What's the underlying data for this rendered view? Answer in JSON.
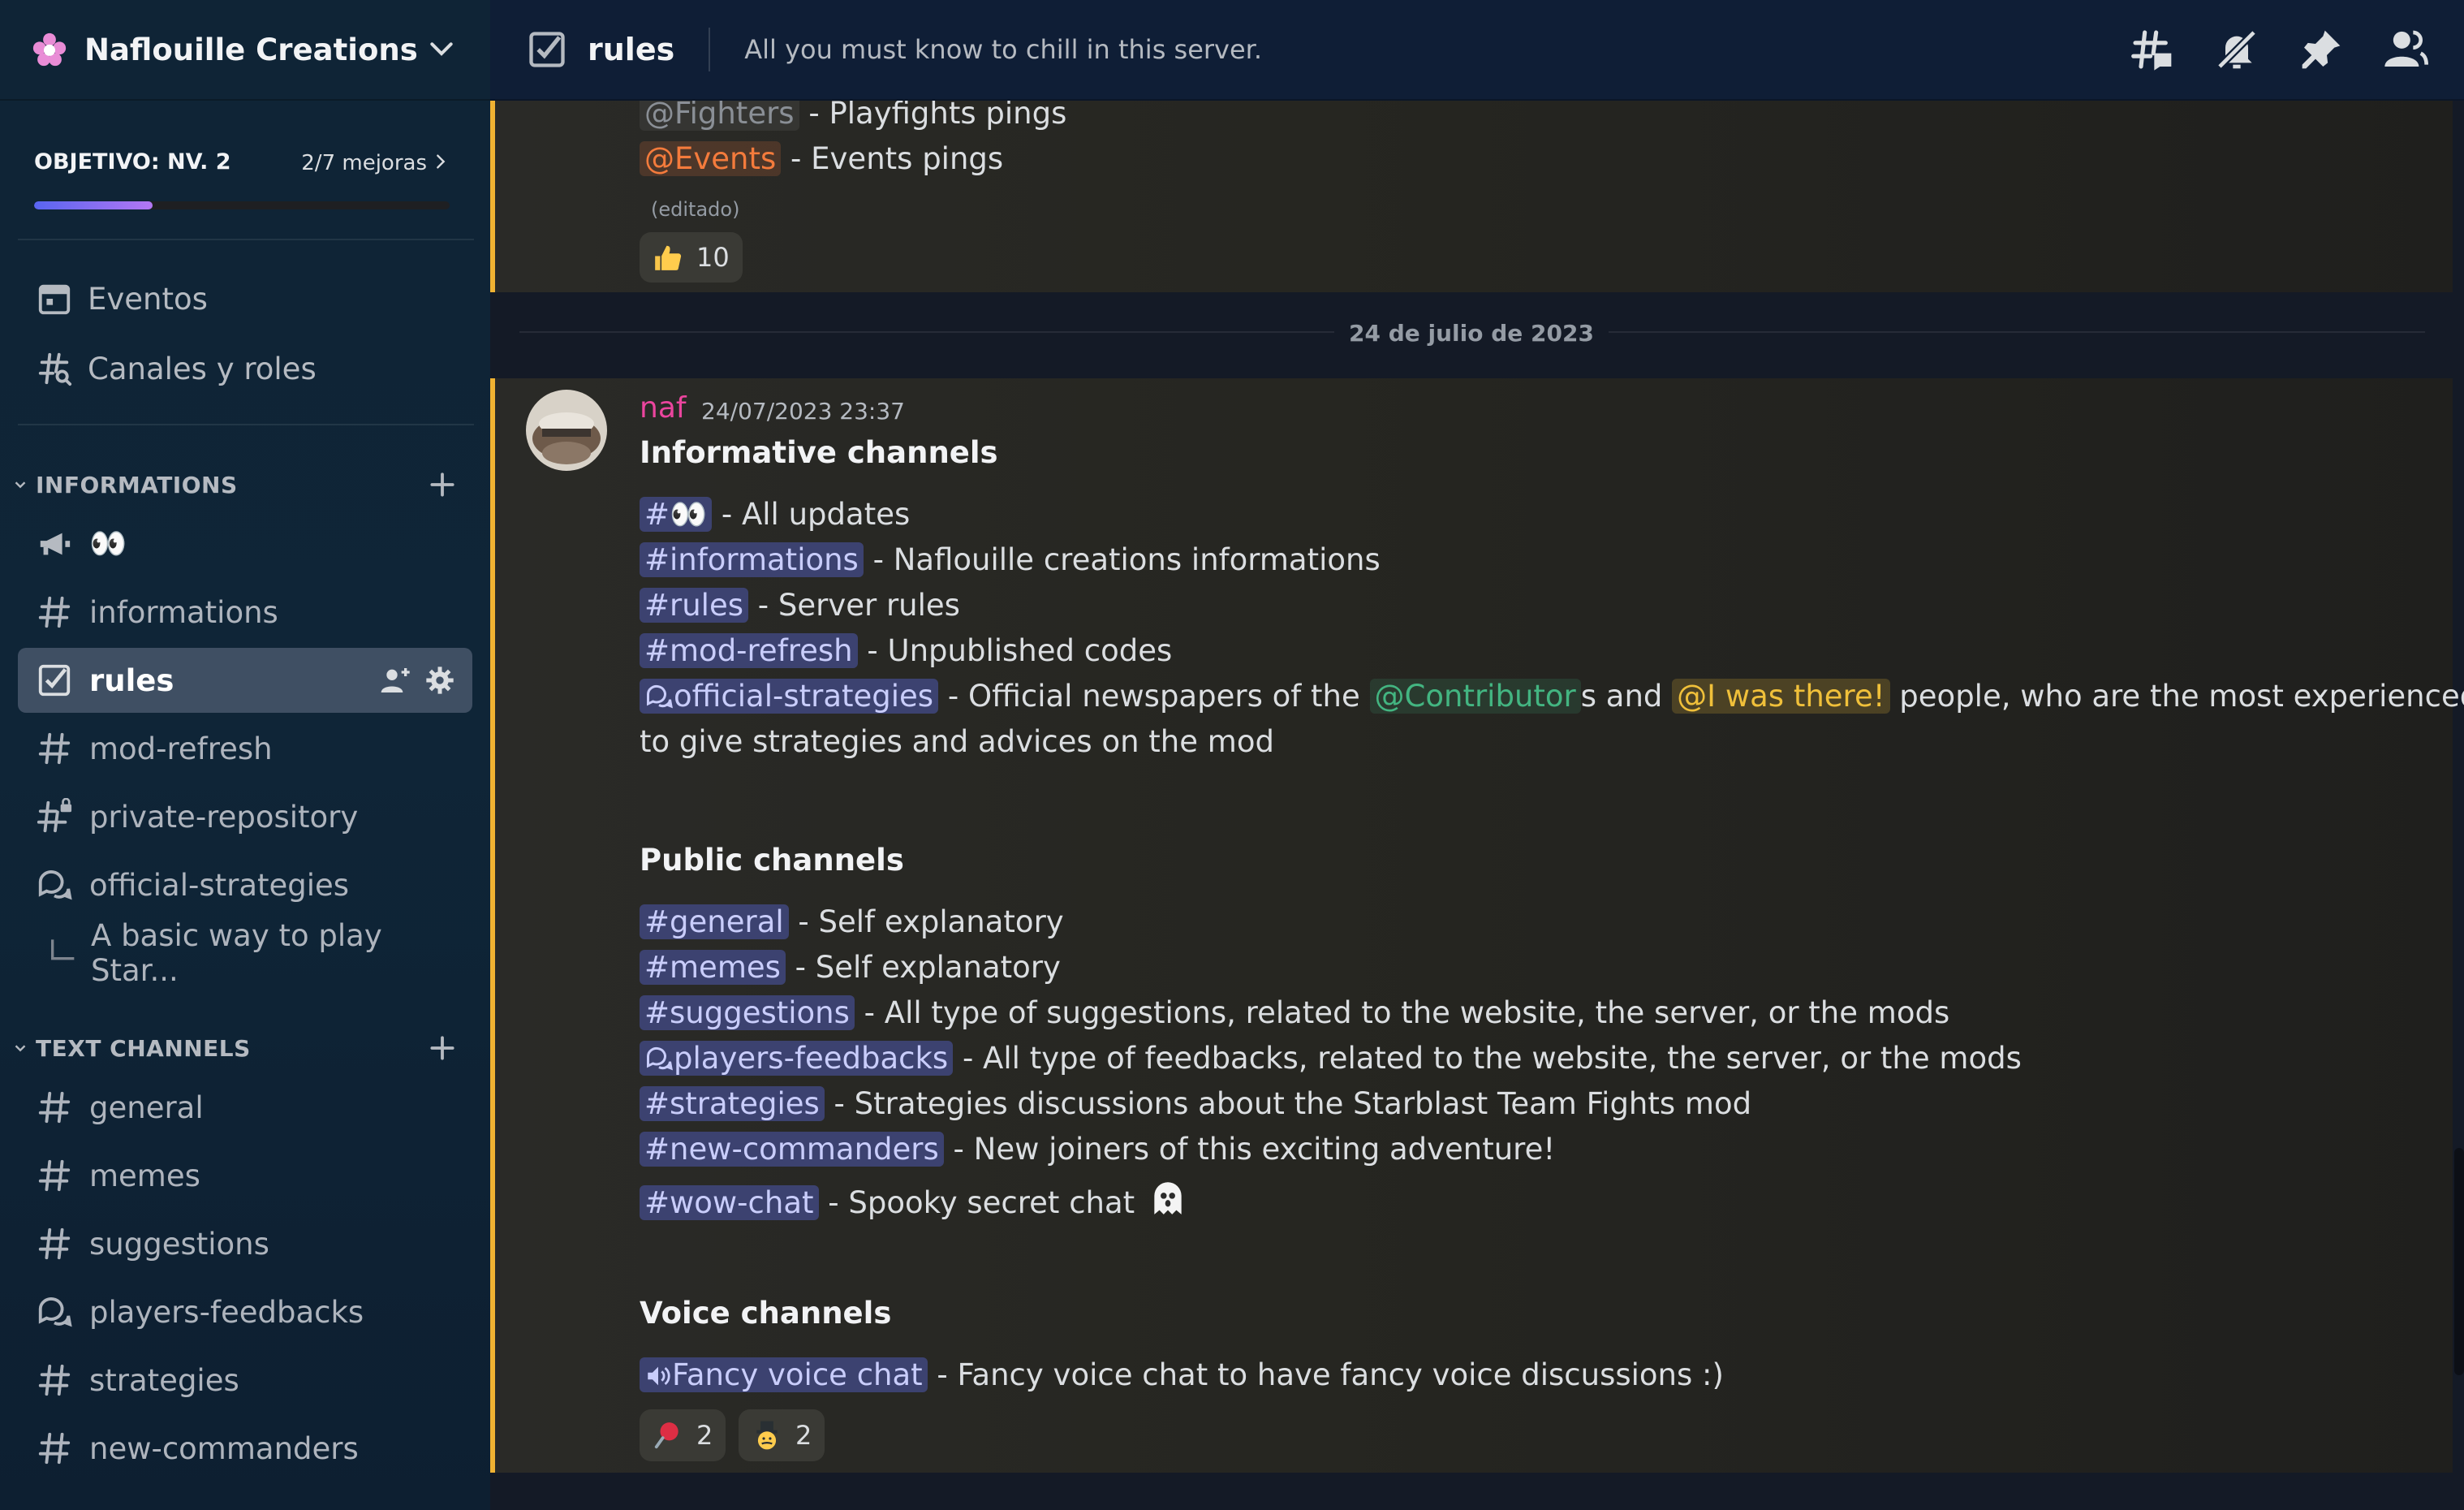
{
  "server": {
    "name": "Naflouille Creations"
  },
  "boost": {
    "goal": "OBJETIVO: NV. 2",
    "progress_text": "2/7 mejoras",
    "progress_fraction": 0.286
  },
  "sidebar": {
    "events": "Eventos",
    "channels_roles": "Canales y roles",
    "categories": {
      "informations": "INFORMATIONS",
      "text_channels": "TEXT CHANNELS"
    },
    "info_channels": [
      {
        "label": "👀",
        "icon": "megaphone-icon"
      },
      {
        "label": "informations",
        "icon": "hash-icon"
      },
      {
        "label": "rules",
        "icon": "rules-checkbox-icon",
        "active": true
      },
      {
        "label": "mod-refresh",
        "icon": "hash-icon"
      },
      {
        "label": "private-repository",
        "icon": "hash-lock-icon"
      },
      {
        "label": "official-strategies",
        "icon": "forum-icon"
      },
      {
        "label": "A basic way to play Star...",
        "icon": "thread-spine-icon"
      }
    ],
    "text_channels": [
      {
        "label": "general",
        "icon": "hash-icon"
      },
      {
        "label": "memes",
        "icon": "hash-icon"
      },
      {
        "label": "suggestions",
        "icon": "hash-icon"
      },
      {
        "label": "players-feedbacks",
        "icon": "forum-icon"
      },
      {
        "label": "strategies",
        "icon": "hash-icon"
      },
      {
        "label": "new-commanders",
        "icon": "hash-icon"
      }
    ]
  },
  "topbar": {
    "channel": "rules",
    "topic": "All you must know to chill in this server."
  },
  "top_message": {
    "fighters_mention": "@Fighters",
    "fighters_text": " - Playfights pings",
    "events_mention": "@Events",
    "events_text": "  - Events pings",
    "edited": "(editado)",
    "reaction_count": "10"
  },
  "date_divider": "24 de julio de 2023",
  "main_message": {
    "author": "naf",
    "timestamp": "24/07/2023 23:37",
    "informative": {
      "heading": "Informative channels",
      "lines": [
        {
          "channel": "👀",
          "text": "  - All updates"
        },
        {
          "channel": "informations",
          "text": "  - Naflouille creations informations"
        },
        {
          "channel": "rules",
          "text": " - Server rules"
        },
        {
          "channel": "mod-refresh",
          "text": " - Unpublished codes"
        }
      ],
      "strategies_channel": "official-strategies",
      "strategies_text_a": " - Official newspapers of the ",
      "contributor_mention": "@Contributor",
      "strategies_text_b": "s and ",
      "was_there_mention": "@I was there!",
      "strategies_text_c": " people, who are the most experienced",
      "strategies_text_d": "to give strategies and advices on the mod"
    },
    "public": {
      "heading": "Public channels",
      "lines": [
        {
          "channel": "general",
          "text": "  - Self explanatory"
        },
        {
          "channel": "memes",
          "text": " - Self explanatory"
        },
        {
          "channel": "suggestions",
          "text": " - All type of suggestions, related to the website, the server, or the mods"
        },
        {
          "channel": "players-feedbacks",
          "text": " - All type of feedbacks, related to the website, the server, or the mods"
        },
        {
          "channel": "strategies",
          "text": " - Strategies discussions about the Starblast Team Fights mod"
        },
        {
          "channel": "new-commanders",
          "text": " - New joiners of this exciting adventure!"
        },
        {
          "channel": "wow-chat",
          "text": " - Spooky secret chat "
        }
      ]
    },
    "voice": {
      "heading": "Voice channels",
      "channel": "Fancy voice chat",
      "text": " - Fancy voice chat to have fancy voice discussions :)"
    },
    "reactions": [
      {
        "emoji": "pin-emoji",
        "count": "2"
      },
      {
        "emoji": "gentleman-emoji",
        "count": "2"
      }
    ]
  },
  "colors": {
    "accent": "#5865f2",
    "mention_highlight_border": "#f0b232",
    "author": "#eb459e",
    "contributor": "#43b581",
    "was_there": "#f0c03a",
    "events": "#f47b3c"
  }
}
